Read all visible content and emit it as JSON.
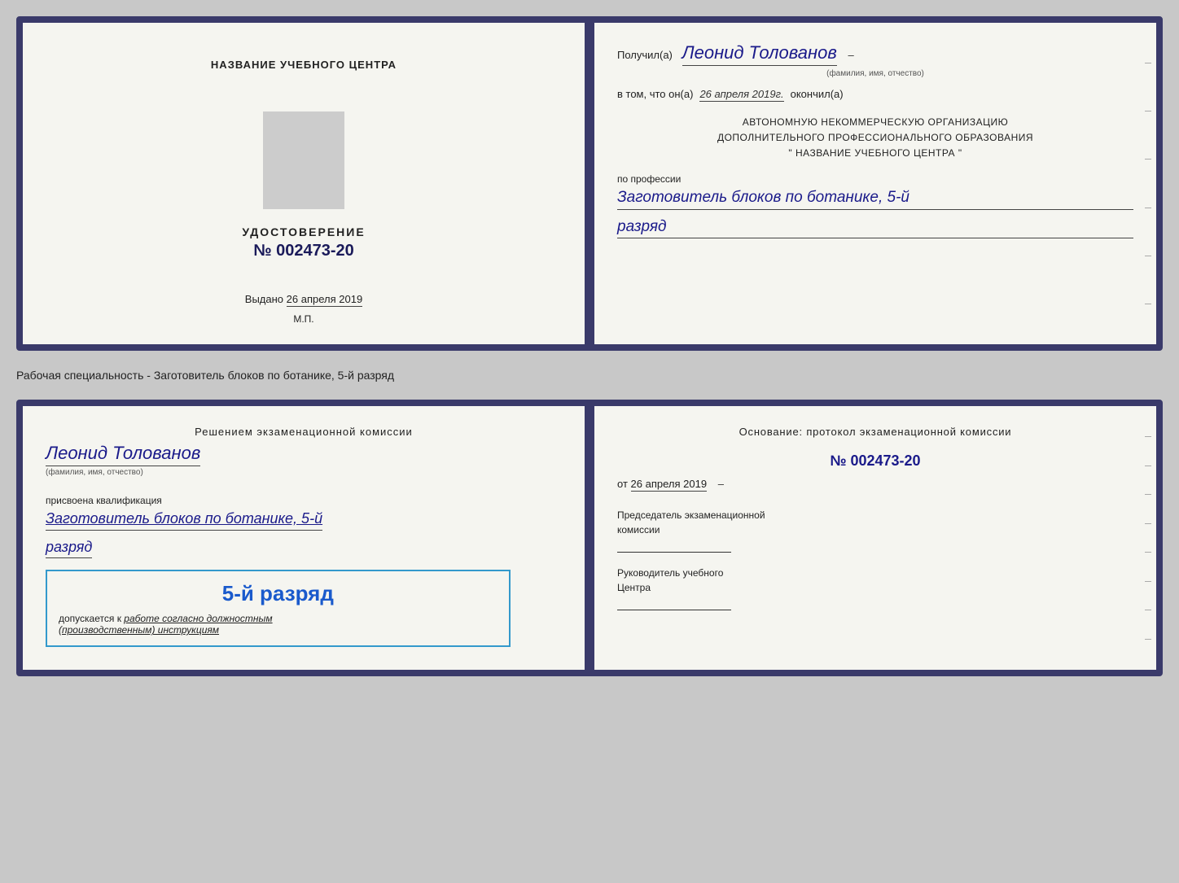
{
  "topCert": {
    "leftSide": {
      "institutionLabel": "НАЗВАНИЕ УЧЕБНОГО ЦЕНТРА",
      "certTitle": "УДОСТОВЕРЕНИЕ",
      "certNumber": "№ 002473-20",
      "issuedLabel": "Выдано",
      "issuedDate": "26 апреля 2019",
      "mpLabel": "М.П."
    },
    "rightSide": {
      "receivedLabel": "Получил(а)",
      "receivedName": "Леонид Толованов",
      "fioLabel": "(фамилия, имя, отчество)",
      "vtomLabel": "в том, что он(а)",
      "vtomDate": "26 апреля 2019г.",
      "okonchill": "окончил(а)",
      "orgLine1": "АВТОНОМНУЮ НЕКОММЕРЧЕСКУЮ ОРГАНИЗАЦИЮ",
      "orgLine2": "ДОПОЛНИТЕЛЬНОГО ПРОФЕССИОНАЛЬНОГО ОБРАЗОВАНИЯ",
      "orgLine3": "\"  НАЗВАНИЕ УЧЕБНОГО ЦЕНТРА  \"",
      "profLabel": "по профессии",
      "profValue": "Заготовитель блоков по ботанике, 5-й",
      "razryadValue": "разряд"
    }
  },
  "subtitle": "Рабочая специальность - Заготовитель блоков по ботанике, 5-й разряд",
  "bottomCert": {
    "leftSide": {
      "decisionLine": "Решением экзаменационной комиссии",
      "decisionName": "Леонид Толованов",
      "fioLabel": "(фамилия, имя, отчество)",
      "assignedLabel": "присвоена квалификация",
      "assignedQual": "Заготовитель блоков по ботанике, 5-й",
      "razryadValue": "разряд",
      "blueBoxTitle": "5-й разряд",
      "dopuskLabel": "допускается к",
      "dopuskValue": "работе согласно должностным",
      "dopuskValue2": "(производственным) инструкциям"
    },
    "rightSide": {
      "osnovLabel": "Основание: протокол экзаменационной комиссии",
      "protNumber": "№  002473-20",
      "otLabel": "от",
      "otDate": "26 апреля 2019",
      "chairmanLabel": "Председатель экзаменационной",
      "chairmanLabel2": "комиссии",
      "rukovLabel": "Руководитель учебного",
      "rukovLabel2": "Центра"
    }
  }
}
